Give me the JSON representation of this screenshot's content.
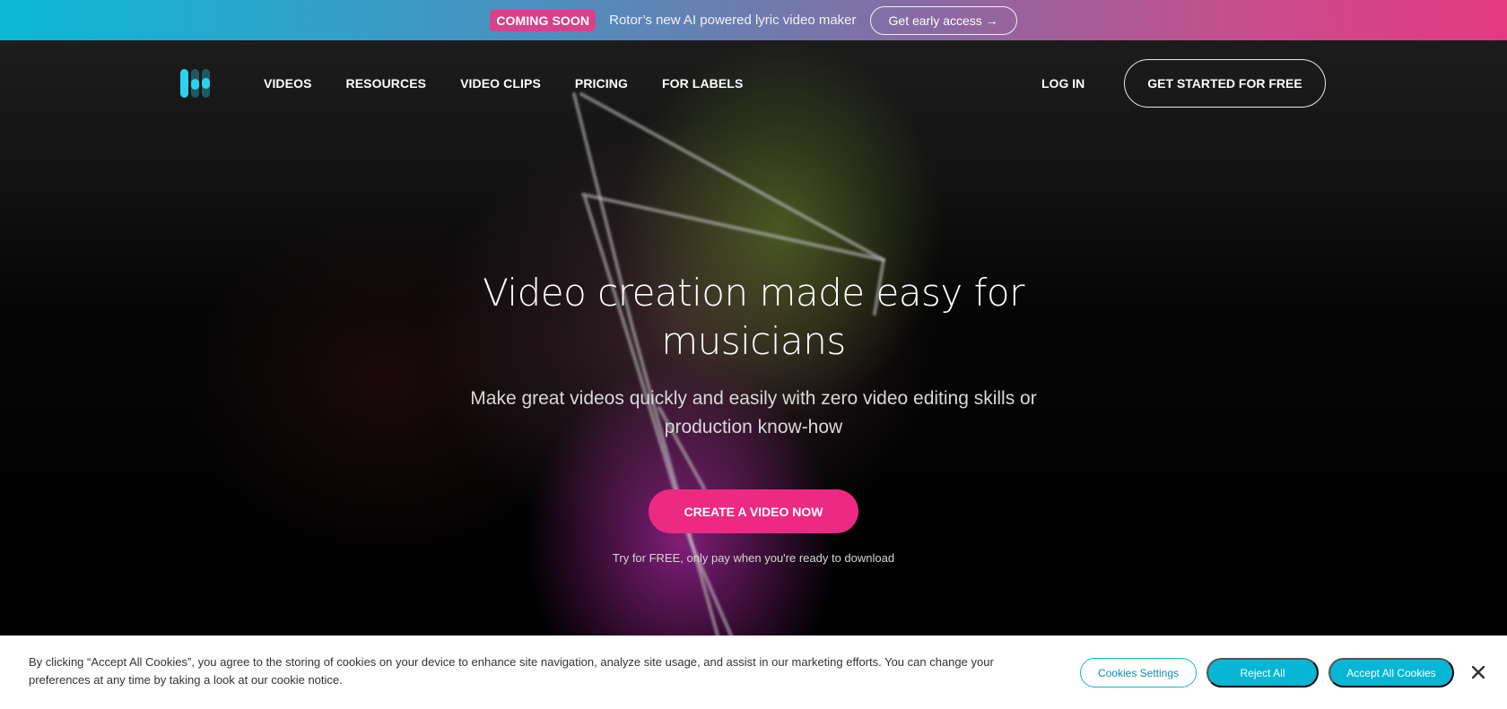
{
  "banner": {
    "badge": "COMING SOON",
    "text": "Rotor’s new AI powered lyric video maker",
    "button": "Get early access →",
    "gradient_start": "#0cb9d7",
    "gradient_end": "#e33a80"
  },
  "nav": {
    "logo_icon": "rotor-logo-icon",
    "links": [
      {
        "label": "VIDEOS"
      },
      {
        "label": "RESOURCES"
      },
      {
        "label": "VIDEO CLIPS"
      },
      {
        "label": "PRICING"
      },
      {
        "label": "FOR LABELS"
      }
    ],
    "login": "LOG IN",
    "cta": "GET STARTED FOR FREE"
  },
  "hero": {
    "title": "Video creation made easy for musicians",
    "subtitle": "Make great videos quickly and easily with zero video editing skills or production know-how",
    "cta": "CREATE A VIDEO NOW",
    "note": "Try for FREE, only pay when you're ready to download",
    "accent": "#ec2a83"
  },
  "cookie": {
    "text": "By clicking “Accept All Cookies”, you agree to the storing of cookies on your device to enhance site navigation, analyze site usage, and assist in our marketing efforts. You can change your preferences at any time by taking a look at our cookie notice.",
    "settings": "Cookies Settings",
    "reject": "Reject All",
    "accept": "Accept All Cookies",
    "close_icon": "close-icon",
    "accent": "#07b6d4"
  }
}
